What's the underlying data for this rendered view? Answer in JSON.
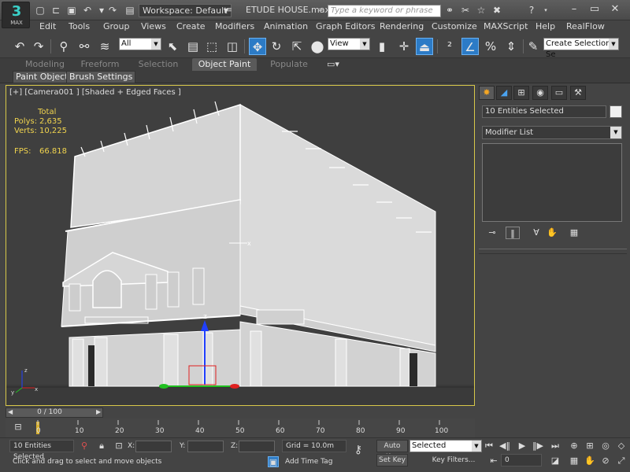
{
  "app": {
    "logo_text": "MAX",
    "file_title": "ETUDE HOUSE.max",
    "workspace": "Workspace: Default",
    "search_placeholder": "Type a keyword or phrase"
  },
  "menu": [
    "Edit",
    "Tools",
    "Group",
    "Views",
    "Create",
    "Modifiers",
    "Animation",
    "Graph Editors",
    "Rendering",
    "Customize",
    "MAXScript",
    "Help",
    "RealFlow"
  ],
  "toolbar": {
    "selection_filter": "All",
    "ref_coord": "View",
    "named_selection": "Create Selection Se"
  },
  "ribbon": {
    "tabs": [
      "Modeling",
      "Freeform",
      "Selection",
      "Object Paint",
      "Populate"
    ],
    "active_tab": "Object Paint",
    "subtabs": [
      "Paint Objects",
      "Brush Settings"
    ]
  },
  "viewport": {
    "label": "[+] [Camera001 ] [Shaded + Edged Faces ]",
    "stats": {
      "total_label": "Total",
      "polys_label": "Polys:",
      "polys_value": "2,635",
      "verts_label": "Verts:",
      "verts_value": "10,225",
      "fps_label": "FPS:",
      "fps_value": "66.818"
    },
    "gizmo_labels": {
      "z": "z",
      "x": "x",
      "y": "y"
    }
  },
  "command_panel": {
    "selection_name": "10 Entities Selected",
    "modifier_list": "Modifier List"
  },
  "timeline": {
    "frame_display": "0 / 100",
    "ticks": [
      "0",
      "10",
      "20",
      "30",
      "40",
      "50",
      "60",
      "70",
      "80",
      "90",
      "100"
    ]
  },
  "status": {
    "selection": "10 Entities Selected",
    "prompt": "Click and drag to select and move objects",
    "x_label": "X:",
    "y_label": "Y:",
    "z_label": "Z:",
    "grid": "Grid = 10.0m",
    "add_time_tag": "Add Time Tag",
    "auto_key": "Auto Key",
    "set_key": "Set Key",
    "key_mode": "Selected",
    "key_filters": "Key Filters...",
    "current_frame": "0"
  },
  "colors": {
    "accent": "#2c7bc6",
    "viewport_border": "#d8c84a",
    "stats_text": "#f1d44e",
    "gizmo_x": "#e02020",
    "gizmo_y": "#20c020",
    "gizmo_z": "#2040ff"
  }
}
